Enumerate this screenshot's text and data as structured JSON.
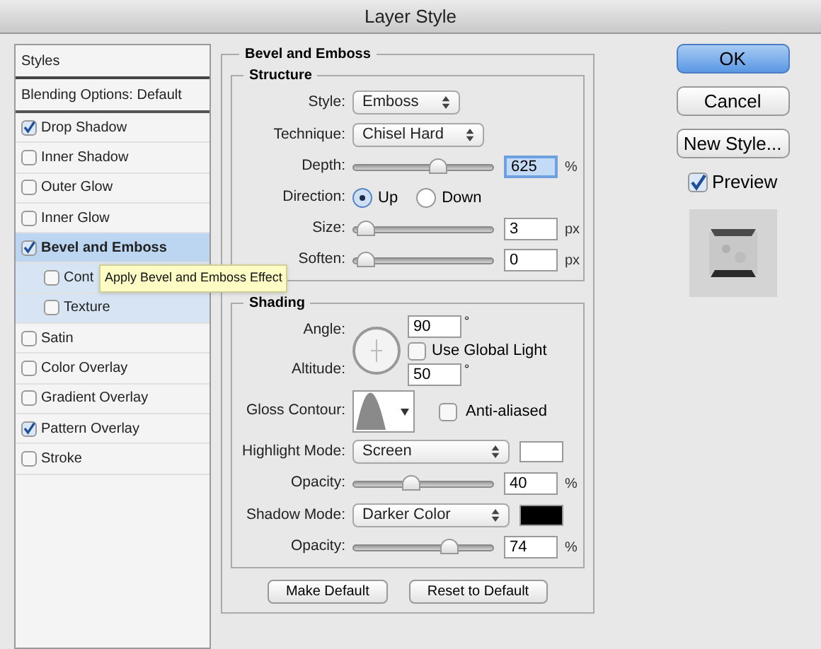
{
  "window": {
    "title": "Layer Style"
  },
  "styles_panel": {
    "header": "Styles",
    "items": [
      {
        "kind": "heading",
        "label": "Blending Options: Default"
      },
      {
        "kind": "check",
        "label": "Drop Shadow",
        "checked": true,
        "selected": false
      },
      {
        "kind": "check",
        "label": "Inner Shadow",
        "checked": false,
        "selected": false
      },
      {
        "kind": "check",
        "label": "Outer Glow",
        "checked": false,
        "selected": false
      },
      {
        "kind": "check",
        "label": "Inner Glow",
        "checked": false,
        "selected": false
      },
      {
        "kind": "check",
        "label": "Bevel and Emboss",
        "checked": true,
        "selected": true,
        "children": [
          {
            "label": "Cont",
            "checked": false
          },
          {
            "label": "Texture",
            "checked": false
          }
        ]
      },
      {
        "kind": "check",
        "label": "Satin",
        "checked": false,
        "selected": false
      },
      {
        "kind": "check",
        "label": "Color Overlay",
        "checked": false,
        "selected": false
      },
      {
        "kind": "check",
        "label": "Gradient Overlay",
        "checked": false,
        "selected": false
      },
      {
        "kind": "check",
        "label": "Pattern Overlay",
        "checked": true,
        "selected": false
      },
      {
        "kind": "check",
        "label": "Stroke",
        "checked": false,
        "selected": false
      }
    ]
  },
  "tooltip": "Apply Bevel and Emboss Effect",
  "section_title": "Bevel and Emboss",
  "groups": [
    {
      "title": "Structure",
      "rows": [
        {
          "kind": "select",
          "label": "Style:",
          "value": "Emboss"
        },
        {
          "kind": "select",
          "label": "Technique:",
          "value": "Chisel Hard"
        },
        {
          "kind": "slider",
          "label": "Depth:",
          "level": 0.62,
          "value": "625",
          "unit": "%",
          "focused": true
        },
        {
          "kind": "radio",
          "label": "Direction:",
          "options": [
            {
              "label": "Up",
              "selected": true
            },
            {
              "label": "Down",
              "selected": false
            }
          ]
        },
        {
          "kind": "slider",
          "label": "Size:",
          "level": 0.02,
          "value": "3",
          "unit": "px",
          "focused": false
        },
        {
          "kind": "slider",
          "label": "Soften:",
          "level": 0.02,
          "value": "0",
          "unit": "px",
          "focused": false
        }
      ]
    },
    {
      "title": "Shading",
      "rows": [
        {
          "kind": "angle",
          "angle_label": "Angle:",
          "angle_value": "90",
          "altitude_label": "Altitude:",
          "altitude_value": "50",
          "unit": "°",
          "global_light": {
            "label": "Use Global Light",
            "checked": false
          }
        },
        {
          "kind": "contour",
          "label": "Gloss Contour:",
          "anti_aliased": {
            "label": "Anti-aliased",
            "checked": false
          }
        },
        {
          "kind": "select",
          "label": "Highlight Mode:",
          "value": "Screen",
          "color": "#ffffff"
        },
        {
          "kind": "slider",
          "label": "Opacity:",
          "level": 0.4,
          "value": "40",
          "unit": "%",
          "focused": false
        },
        {
          "kind": "select",
          "label": "Shadow Mode:",
          "value": "Darker Color",
          "color": "#000000"
        },
        {
          "kind": "slider",
          "label": "Opacity:",
          "level": 0.72,
          "value": "74",
          "unit": "%",
          "focused": false
        }
      ]
    }
  ],
  "bottom_buttons": [
    "Make Default",
    "Reset to Default"
  ],
  "side_buttons": [
    {
      "label": "OK",
      "default": true
    },
    {
      "label": "Cancel",
      "default": false
    },
    {
      "label": "New Style...",
      "default": false
    }
  ],
  "preview": {
    "label": "Preview",
    "checked": true
  }
}
